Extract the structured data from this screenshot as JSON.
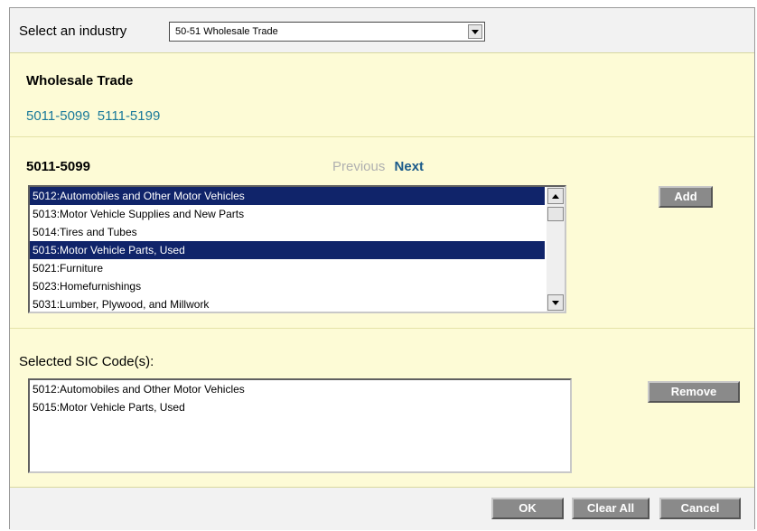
{
  "industry": {
    "label": "Select an industry",
    "selected": "50-51 Wholesale Trade"
  },
  "section": {
    "title": "Wholesale Trade",
    "ranges": [
      "5011-5099",
      "5111-5199"
    ]
  },
  "subrange": {
    "title": "5011-5099",
    "previous_label": "Previous",
    "next_label": "Next"
  },
  "code_list": {
    "items": [
      {
        "text": "5012:Automobiles and Other Motor Vehicles",
        "selected": true
      },
      {
        "text": "5013:Motor Vehicle Supplies and New Parts",
        "selected": false
      },
      {
        "text": "5014:Tires and Tubes",
        "selected": false
      },
      {
        "text": "5015:Motor Vehicle Parts, Used",
        "selected": true
      },
      {
        "text": "5021:Furniture",
        "selected": false
      },
      {
        "text": "5023:Homefurnishings",
        "selected": false
      },
      {
        "text": "5031:Lumber, Plywood, and Millwork",
        "selected": false
      }
    ]
  },
  "add_label": "Add",
  "selected_codes": {
    "label": "Selected SIC Code(s):",
    "items": [
      "5012:Automobiles and Other Motor Vehicles",
      "5015:Motor Vehicle Parts, Used"
    ]
  },
  "remove_label": "Remove",
  "footer": {
    "ok_label": "OK",
    "clear_label": "Clear All",
    "cancel_label": "Cancel"
  },
  "colors": {
    "panel": "#fdfbd6",
    "selection": "#10246a",
    "link": "#1a7a9a",
    "button": "#8a8a8a"
  }
}
